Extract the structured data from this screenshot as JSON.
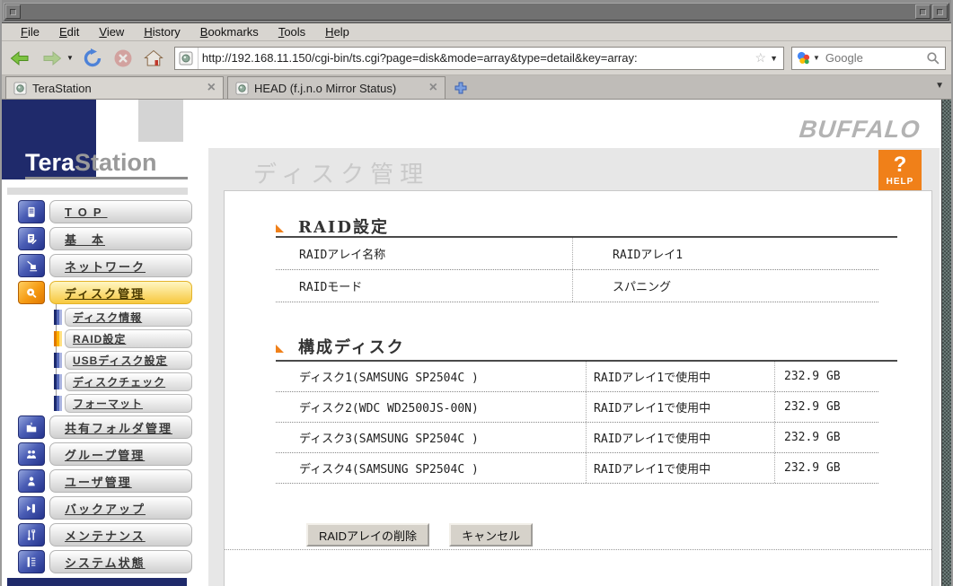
{
  "menubar": {
    "items": [
      "File",
      "Edit",
      "View",
      "History",
      "Bookmarks",
      "Tools",
      "Help"
    ]
  },
  "toolbar": {
    "url": "http://192.168.11.150/cgi-bin/ts.cgi?page=disk&mode=array&type=detail&key=array:",
    "search_placeholder": "Google"
  },
  "tabs": {
    "tab1": "TeraStation",
    "tab2": "HEAD (f.j.n.o Mirror Status)"
  },
  "branding": {
    "tera": "Tera",
    "station": "Station",
    "buffalo": "BUFFALO"
  },
  "help": {
    "q": "?",
    "label": "HELP"
  },
  "page": {
    "title": "ディスク管理"
  },
  "sidebar": {
    "items": [
      {
        "label": "TOP"
      },
      {
        "label": "基　本"
      },
      {
        "label": "ネットワーク"
      },
      {
        "label": "ディスク管理"
      },
      {
        "label": "共有フォルダ管理"
      },
      {
        "label": "グループ管理"
      },
      {
        "label": "ユーザ管理"
      },
      {
        "label": "バックアップ"
      },
      {
        "label": "メンテナンス"
      },
      {
        "label": "システム状態"
      }
    ],
    "disk_submenu": [
      {
        "label": "ディスク情報"
      },
      {
        "label": "RAID設定"
      },
      {
        "label": "USBディスク設定"
      },
      {
        "label": "ディスクチェック"
      },
      {
        "label": "フォーマット"
      }
    ]
  },
  "raid_section": {
    "title": "RAID設定",
    "rows": [
      {
        "label": "RAIDアレイ名称",
        "value": "RAIDアレイ1"
      },
      {
        "label": "RAIDモード",
        "value": "スパニング"
      }
    ]
  },
  "disks_section": {
    "title": "構成ディスク",
    "rows": [
      {
        "name": "ディスク1(SAMSUNG SP2504C )",
        "status": "RAIDアレイ1で使用中",
        "size": "232.9 GB"
      },
      {
        "name": "ディスク2(WDC WD2500JS-00N)",
        "status": "RAIDアレイ1で使用中",
        "size": "232.9 GB"
      },
      {
        "name": "ディスク3(SAMSUNG SP2504C )",
        "status": "RAIDアレイ1で使用中",
        "size": "232.9 GB"
      },
      {
        "name": "ディスク4(SAMSUNG SP2504C )",
        "status": "RAIDアレイ1で使用中",
        "size": "232.9 GB"
      }
    ]
  },
  "actions": {
    "delete": "RAIDアレイの削除",
    "cancel": "キャンセル"
  }
}
